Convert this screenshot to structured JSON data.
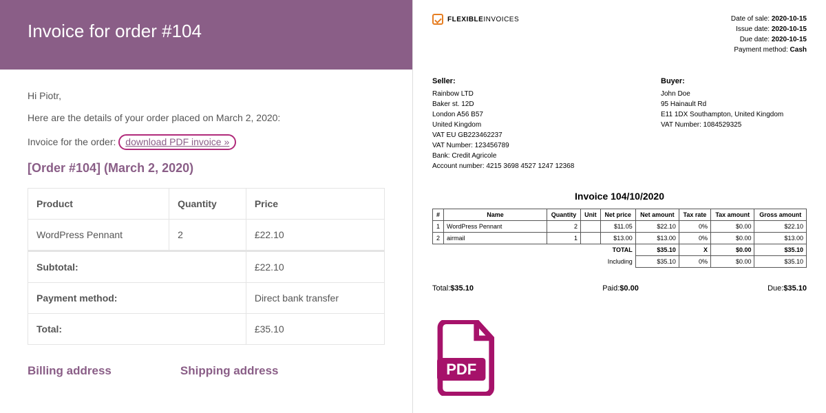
{
  "left": {
    "title": "Invoice for order #104",
    "greeting": "Hi Piotr,",
    "intro": "Here are the details of your order placed on March 2, 2020:",
    "invoice_for": "Invoice for the order:",
    "download_link": "download PDF invoice »",
    "order_heading": "[Order #104] (March 2, 2020)",
    "table": {
      "headers": {
        "product": "Product",
        "quantity": "Quantity",
        "price": "Price"
      },
      "rows": [
        {
          "product": "WordPress Pennant",
          "quantity": "2",
          "price": "£22.10"
        }
      ],
      "totals": [
        {
          "label": "Subtotal:",
          "value": "£22.10"
        },
        {
          "label": "Payment method:",
          "value": "Direct bank transfer"
        },
        {
          "label": "Total:",
          "value": "£35.10"
        }
      ]
    },
    "billing_heading": "Billing address",
    "shipping_heading": "Shipping address"
  },
  "right": {
    "logo": {
      "bold": "FLEXIBLE",
      "light": "INVOICES"
    },
    "meta": {
      "sale_date_label": "Date of sale:",
      "sale_date": "2020-10-15",
      "issue_date_label": "Issue date:",
      "issue_date": "2020-10-15",
      "due_date_label": "Due date:",
      "due_date": "2020-10-15",
      "payment_label": "Payment method:",
      "payment": "Cash"
    },
    "seller": {
      "title": "Seller:",
      "name": "Rainbow LTD",
      "street": "Baker st. 12D",
      "postcode": "London A56 B57",
      "country": "United Kingdom",
      "vat_eu": "VAT EU GB223462237",
      "vat_no": "VAT Number: 123456789",
      "bank": "Bank: Credit Agricole",
      "account": "Account number: 4215 3698 4527 1247 12368"
    },
    "buyer": {
      "title": "Buyer:",
      "name": "John Doe",
      "street": "95 Hainault Rd",
      "city": "E11 1DX Southampton, United Kingdom",
      "vat_no": "VAT Number: 1084529325"
    },
    "invoice_title": "Invoice 104/10/2020",
    "inv_headers": [
      "#",
      "Name",
      "Quantity",
      "Unit",
      "Net price",
      "Net amount",
      "Tax rate",
      "Tax amount",
      "Gross amount"
    ],
    "inv_rows": [
      {
        "n": "1",
        "name": "WordPress Pennant",
        "qty": "2",
        "unit": "",
        "netp": "$11.05",
        "neta": "$22.10",
        "taxr": "0%",
        "taxa": "$0.00",
        "gross": "$22.10"
      },
      {
        "n": "2",
        "name": "airmail",
        "qty": "1",
        "unit": "",
        "netp": "$13.00",
        "neta": "$13.00",
        "taxr": "0%",
        "taxa": "$0.00",
        "gross": "$13.00"
      }
    ],
    "inv_totals": [
      {
        "label": "TOTAL",
        "neta": "$35.10",
        "taxr": "X",
        "taxa": "$0.00",
        "gross": "$35.10",
        "bold": true
      },
      {
        "label": "Including",
        "neta": "$35.10",
        "taxr": "0%",
        "taxa": "$0.00",
        "gross": "$35.10",
        "bold": false
      }
    ],
    "summary": {
      "total_label": "Total:",
      "total": "$35.10",
      "paid_label": "Paid:",
      "paid": "$0.00",
      "due_label": "Due:",
      "due": "$35.10"
    },
    "pdf_label": "PDF"
  }
}
